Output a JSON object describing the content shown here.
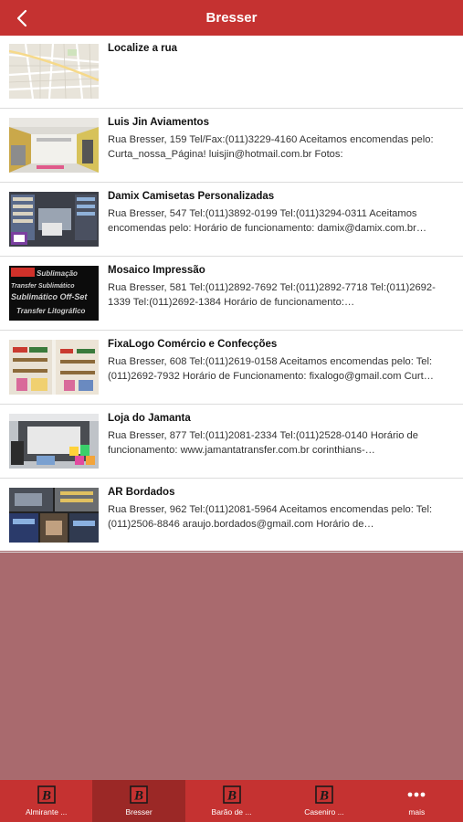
{
  "header": {
    "title": "Bresser",
    "back_icon": "chevron-left-icon"
  },
  "colors": {
    "brand_red": "#c53231",
    "active_tab": "#9b2826",
    "background": "#a96a6e"
  },
  "list": {
    "items": [
      {
        "name": "Localize a rua",
        "description": ""
      },
      {
        "name": "Luis Jin Aviamentos",
        "description": "Rua Bresser, 159 Tel/Fax:(011)3229-4160 Aceitamos encomendas pelo: Curta_nossa_Página! luisjin@hotmail.com.br Fotos:"
      },
      {
        "name": "Damix Camisetas Personalizadas",
        "description": "Rua Bresser, 547 Tel:(011)3892-0199 Tel:(011)3294-0311 Aceitamos encomendas pelo: Horário de funcionamento: damix@damix.com.br…"
      },
      {
        "name": "Mosaico Impressão",
        "description": "Rua Bresser, 581 Tel:(011)2892-7692 Tel:(011)2892-7718 Tel:(011)2692-1339 Tel:(011)2692-1384 Horário de funcionamento:…"
      },
      {
        "name": "FixaLogo Comércio e Confecções",
        "description": "Rua Bresser, 608 Tel:(011)2619-0158 Aceitamos encomendas pelo: Tel:(011)2692-7932 Horário de Funcionamento: fixalogo@gmail.com Curt…"
      },
      {
        "name": "Loja do Jamanta",
        "description": "Rua Bresser, 877 Tel:(011)2081-2334 Tel:(011)2528-0140 Horário de funcionamento: www.jamantatransfer.com.br corinthians-…"
      },
      {
        "name": "AR Bordados",
        "description": "Rua Bresser, 962 Tel:(011)2081-5964 Aceitamos encomendas pelo: Tel:(011)2506-8846 araujo.bordados@gmail.com Horário de…"
      }
    ]
  },
  "thumbnails": {
    "mosaico_text": [
      "Sublimação",
      "Transfer Sublimático",
      "Sublimático Off-Set",
      "Transfer Litográfico"
    ]
  },
  "tabbar": {
    "tabs": [
      {
        "label": "Almirante ...",
        "icon": "b-logo-icon",
        "active": false
      },
      {
        "label": "Bresser",
        "icon": "b-logo-icon",
        "active": true
      },
      {
        "label": "Barão de ...",
        "icon": "b-logo-icon",
        "active": false
      },
      {
        "label": "Caseniro ...",
        "icon": "b-logo-icon",
        "active": false
      },
      {
        "label": "mais",
        "icon": "more-dots-icon",
        "active": false
      }
    ]
  }
}
